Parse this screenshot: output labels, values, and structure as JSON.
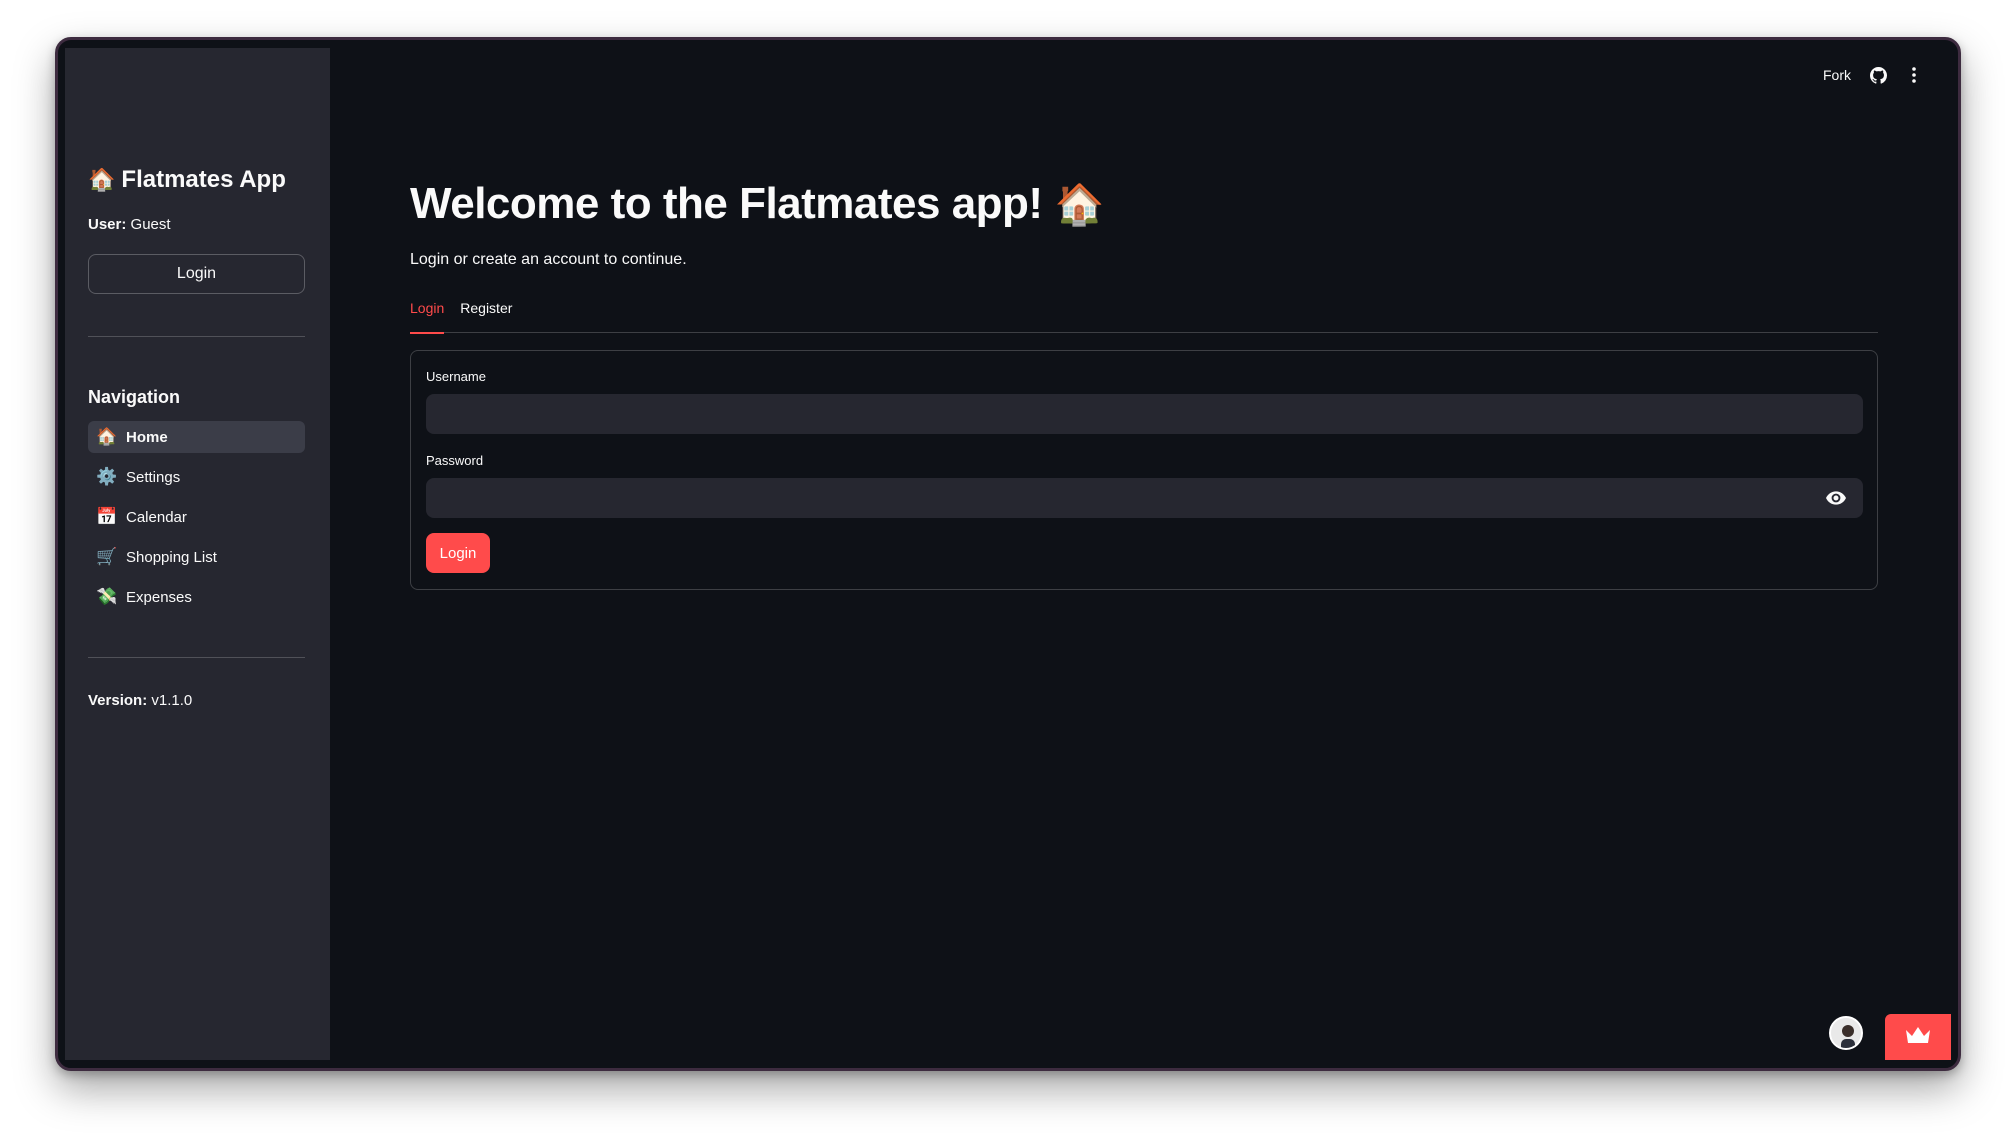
{
  "sidebar": {
    "app_title": "Flatmates App",
    "app_icon": "house-emoji",
    "user_label": "User:",
    "user_value": "Guest",
    "login_button": "Login",
    "nav_title": "Navigation",
    "nav_items": [
      {
        "label": "Home",
        "icon": "🏠",
        "active": true
      },
      {
        "label": "Settings",
        "icon": "⚙️",
        "active": false
      },
      {
        "label": "Calendar",
        "icon": "📅",
        "active": false
      },
      {
        "label": "Shopping List",
        "icon": "🛒",
        "active": false
      },
      {
        "label": "Expenses",
        "icon": "💸",
        "active": false
      }
    ],
    "version_label": "Version:",
    "version_value": "v1.1.0"
  },
  "toolbar": {
    "fork_label": "Fork",
    "icons": [
      "github-icon",
      "more-vertical-icon"
    ]
  },
  "main": {
    "title": "Welcome to the Flatmates app!",
    "title_icon": "🏠",
    "subtitle": "Login or create an account to continue.",
    "tabs": [
      {
        "label": "Login",
        "active": true
      },
      {
        "label": "Register",
        "active": false
      }
    ],
    "form": {
      "username_label": "Username",
      "username_value": "",
      "password_label": "Password",
      "password_value": "",
      "submit_label": "Login"
    }
  },
  "colors": {
    "accent": "#ff4b4b",
    "background": "#0e1117",
    "sidebar_bg": "#262730",
    "input_bg": "#262730",
    "text": "#fafafa"
  }
}
